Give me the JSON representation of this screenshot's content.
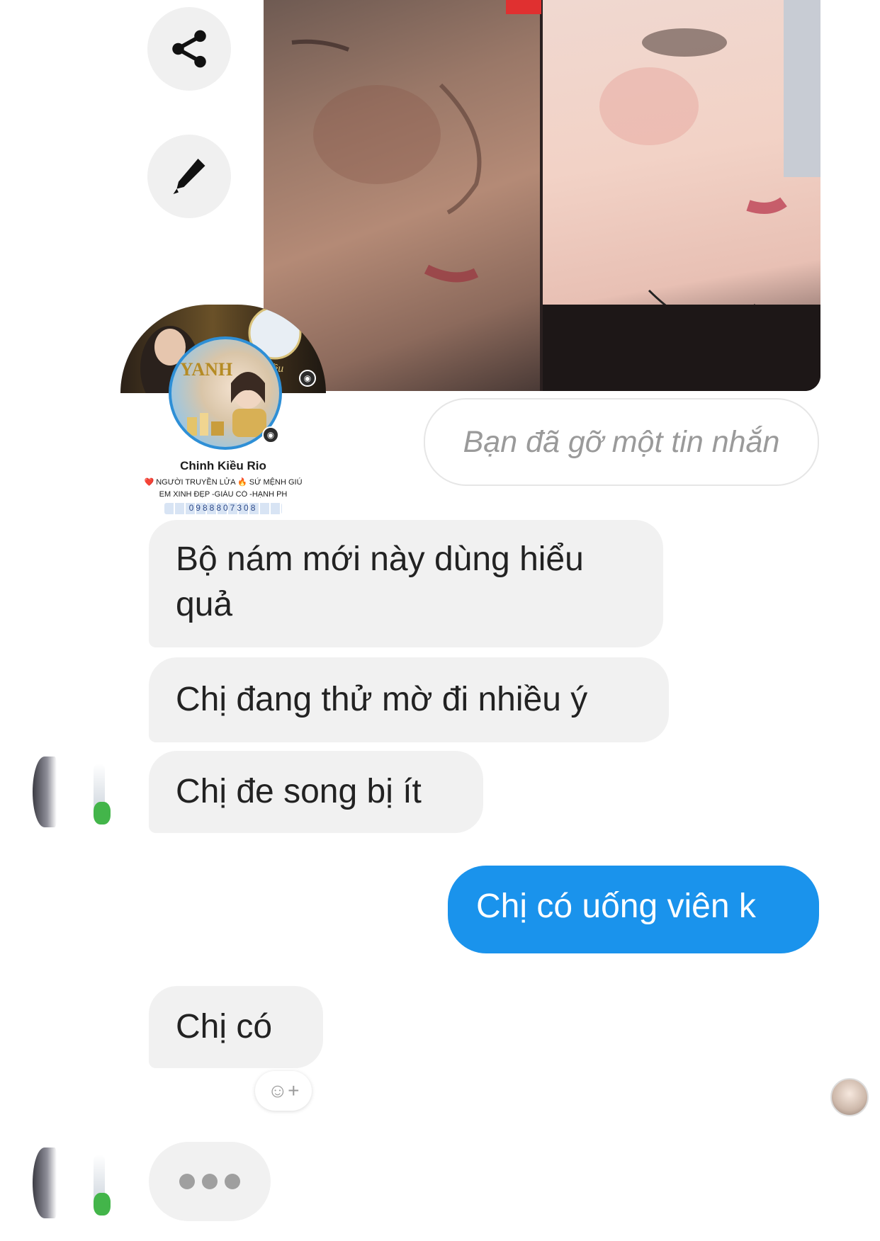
{
  "actions": {
    "share_icon": "share-icon",
    "edit_icon": "pencil-icon"
  },
  "profile": {
    "name": "Chinh Kiều Rio",
    "bio_line1": "❤️ NGƯỜI TRUYỀN LỬA 🔥 SỨ MỆNH GIÚ",
    "bio_line2": "EM XINH ĐẸP -GIÀU CÓ -HẠNH PH",
    "phone": "0988807308",
    "brand": "YANH"
  },
  "messages": {
    "removed_notice": "Bạn đã gỡ một tin nhắn",
    "recv_1": "Bộ nám mới này dùng hiểu quả",
    "recv_2": "Chị đang thử mờ đi nhiều ý",
    "recv_3": "Chị đe song bị ít",
    "sent_1": "Chị có uống viên k",
    "recv_4": "Chị  có"
  },
  "reaction": {
    "icon": "add-reaction-icon",
    "label": "☺+"
  },
  "colors": {
    "sent_bubble": "#1a93ec",
    "recv_bubble": "#f1f1f1",
    "removed_text": "#9a9a9a"
  }
}
